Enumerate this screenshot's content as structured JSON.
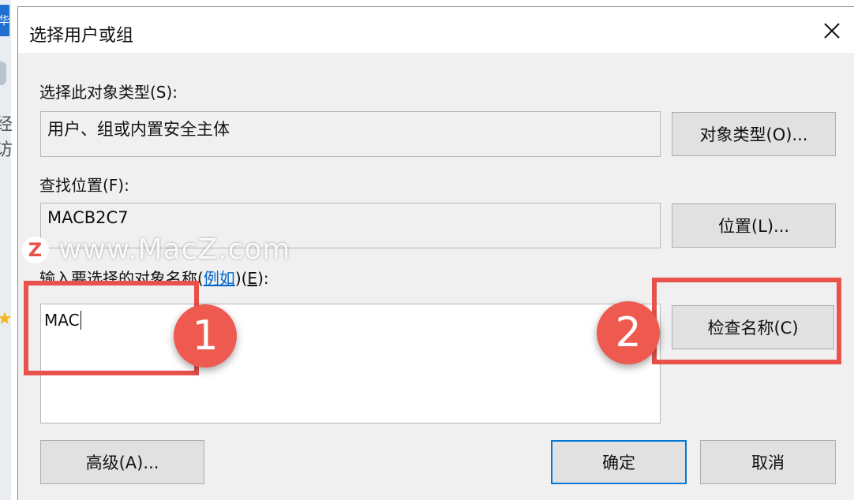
{
  "background": {
    "tab_char": "华",
    "chars": [
      "经",
      "访"
    ]
  },
  "dialog": {
    "title": "选择用户或组",
    "object_type_label": "选择此对象类型(S):",
    "object_type_value": "用户、组或内置安全主体",
    "object_types_button": "对象类型(O)...",
    "location_label": "查找位置(F):",
    "location_value": "MACB2C7",
    "locations_button": "位置(L)...",
    "enter_names_prefix": "输入要选择的对象名称(",
    "example_link": "例如",
    "enter_names_suffix_1": ")(",
    "enter_names_key": "E",
    "enter_names_suffix_2": "):",
    "names_input_value": "MAC",
    "check_names_button": "检查名称(C)",
    "advanced_button": "高级(A)...",
    "ok_button": "确定",
    "cancel_button": "取消"
  },
  "annotations": {
    "step1": "1",
    "step2": "2",
    "accent_color": "#e8524b"
  },
  "watermark": {
    "logo_letter": "Z",
    "text": "www.MacZ.com"
  }
}
